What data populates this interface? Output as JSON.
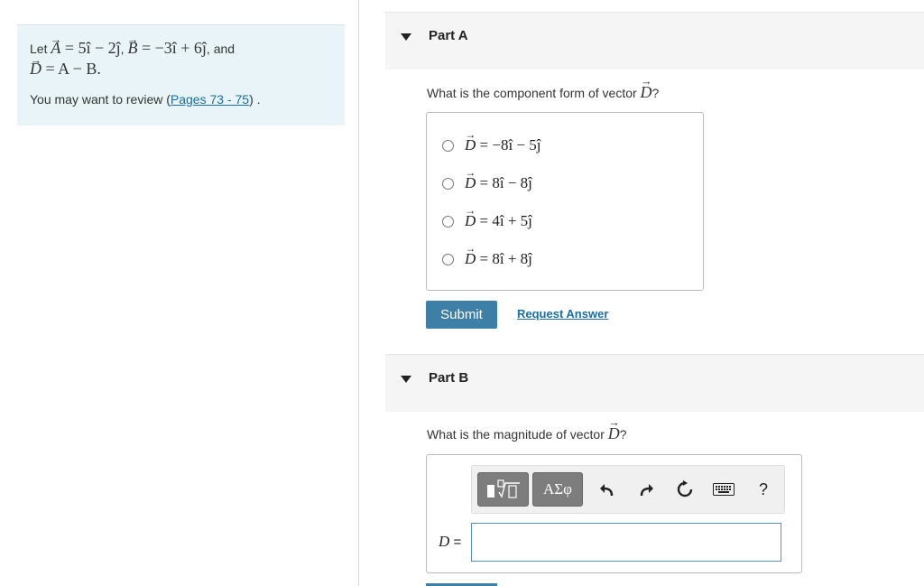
{
  "intro": {
    "let": "Let ",
    "A_def": "= 5î − 2ĵ",
    "comma1": ", ",
    "B_def": "= −3î + 6ĵ",
    "and": ", and",
    "D_def": "= A − B.",
    "review_prefix": "You may want to review (",
    "review_link": "Pages 73 - 75",
    "review_suffix": ") ."
  },
  "partA": {
    "title": "Part A",
    "question_prefix": "What is the component form of vector ",
    "question_suffix": "?",
    "choices": [
      {
        "expr": "= −8î − 5ĵ"
      },
      {
        "expr": "= 8î − 8ĵ"
      },
      {
        "expr": "= 4î + 5ĵ"
      },
      {
        "expr": "= 8î + 8ĵ"
      }
    ],
    "submit_label": "Submit",
    "request_label": "Request Answer"
  },
  "partB": {
    "title": "Part B",
    "question_prefix": "What is the magnitude of vector ",
    "question_suffix": "?",
    "toolbar": {
      "greek_label": "ΑΣφ",
      "help_label": "?"
    },
    "answer_var": "D",
    "answer_eq": " ="
  },
  "colors": {
    "accent": "#3d7fa6",
    "link": "#1a6fa3",
    "intro_bg": "#e8f4f7"
  }
}
